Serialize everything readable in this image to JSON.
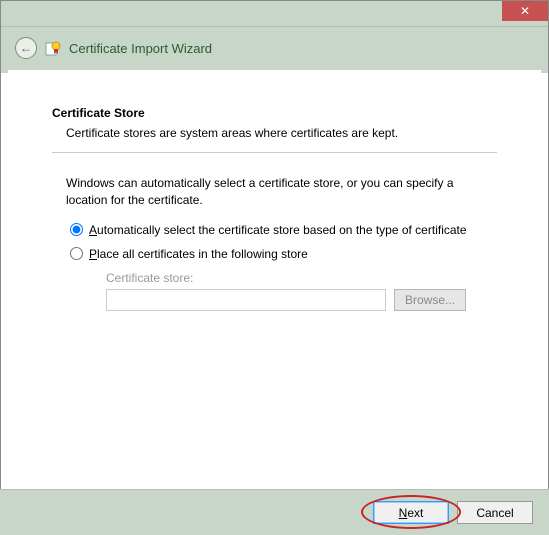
{
  "titlebar": {
    "close_glyph": "✕"
  },
  "header": {
    "back_glyph": "←",
    "title": "Certificate Import Wizard"
  },
  "section": {
    "title": "Certificate Store",
    "desc": "Certificate stores are system areas where certificates are kept."
  },
  "body": {
    "intro": "Windows can automatically select a certificate store, or you can specify a location for the certificate.",
    "radio_auto": "utomatically select the certificate store based on the type of certificate",
    "radio_auto_acc": "A",
    "radio_place": "lace all certificates in the following store",
    "radio_place_acc": "P",
    "store_label": "Certificate store:",
    "store_value": "",
    "browse_label_acc": "B",
    "browse_label_rest": "rowse..."
  },
  "footer": {
    "next_acc": "N",
    "next_rest": "ext",
    "cancel": "Cancel"
  }
}
